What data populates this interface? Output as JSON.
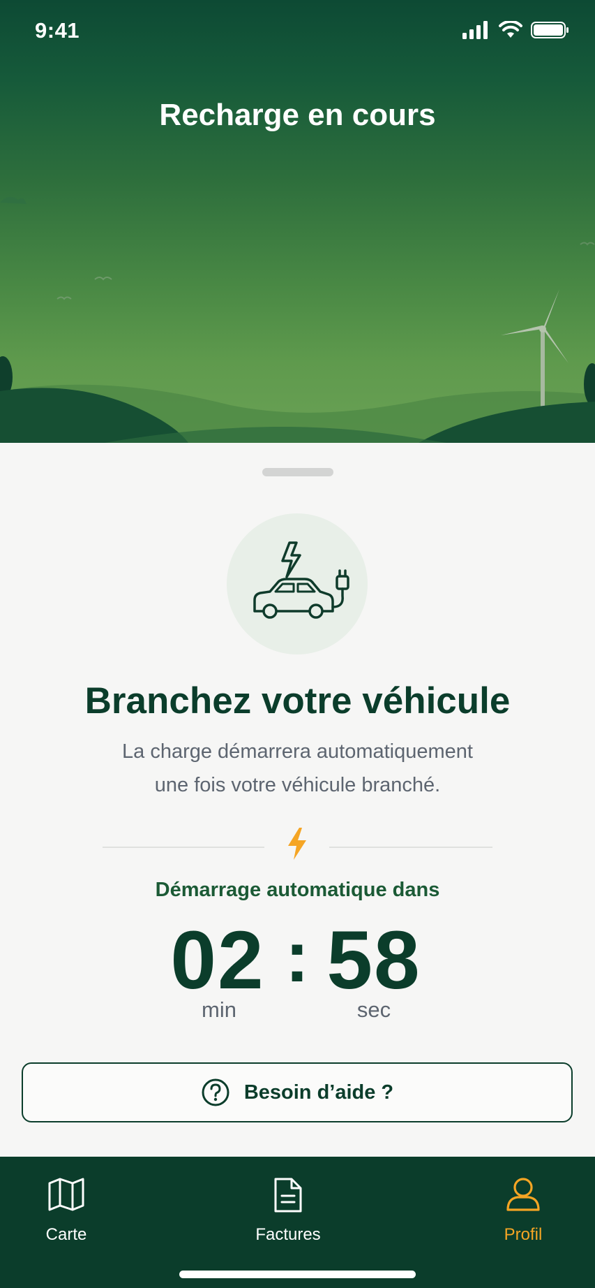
{
  "status_bar": {
    "time": "9:41"
  },
  "header": {
    "title": "Recharge en cours"
  },
  "sheet": {
    "title": "Branchez votre véhicule",
    "description_line1": "La charge démarrera automatiquement",
    "description_line2": "une fois votre véhicule branché.",
    "countdown": {
      "label": "Démarrage automatique dans",
      "minutes": "02",
      "separator": ":",
      "seconds": "58",
      "minutes_unit": "min",
      "seconds_unit": "sec"
    },
    "help_button": {
      "label": "Besoin d’aide ?"
    }
  },
  "tabbar": {
    "items": [
      {
        "label": "Carte",
        "icon": "map-icon",
        "active": false
      },
      {
        "label": "Factures",
        "icon": "document-icon",
        "active": false
      },
      {
        "label": "Profil",
        "icon": "user-icon",
        "active": true
      }
    ]
  },
  "colors": {
    "brand_dark": "#0b3d2b",
    "accent": "#f5a524",
    "text_muted": "#5d6570"
  }
}
